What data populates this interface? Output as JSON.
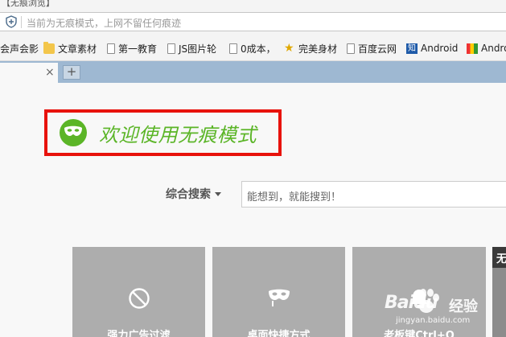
{
  "window": {
    "title": "【无痕浏览】"
  },
  "address_bar": {
    "placeholder": "当前为无痕模式，上网不留任何痕迹"
  },
  "bookmarks": [
    {
      "label": "会声会影",
      "icon": "none"
    },
    {
      "label": "文章素材",
      "icon": "folder-icon"
    },
    {
      "label": "第一教育",
      "icon": "page-icon"
    },
    {
      "label": "JS图片轮",
      "icon": "page-icon"
    },
    {
      "label": "0成本，",
      "icon": "page-icon"
    },
    {
      "label": "完美身材",
      "icon": "star-icon"
    },
    {
      "label": "百度云网",
      "icon": "page-icon"
    },
    {
      "label": "Android",
      "icon": "zhihu-icon"
    },
    {
      "label": "Andro",
      "icon": "mosaic-icon"
    }
  ],
  "tabs": {
    "close_glyph": "×",
    "new_tab_glyph": "+"
  },
  "banner": {
    "text": "欢迎使用无痕模式",
    "accent_color": "#5bb527",
    "frame_color": "#e8120c"
  },
  "search": {
    "engine_label": "综合搜索",
    "placeholder": "能想到，就能搜到！"
  },
  "tiles": [
    {
      "label": "强力广告过滤",
      "icon": "block-icon"
    },
    {
      "label": "桌面快捷方式",
      "icon": "mask-icon"
    },
    {
      "label": "老板键Ctrl+Q",
      "icon": "bell-icon"
    },
    {
      "label": "无",
      "icon": "none"
    }
  ],
  "watermark": {
    "brand": "Baidu",
    "suffix": "经验",
    "url": "jingyan.baidu.com"
  }
}
